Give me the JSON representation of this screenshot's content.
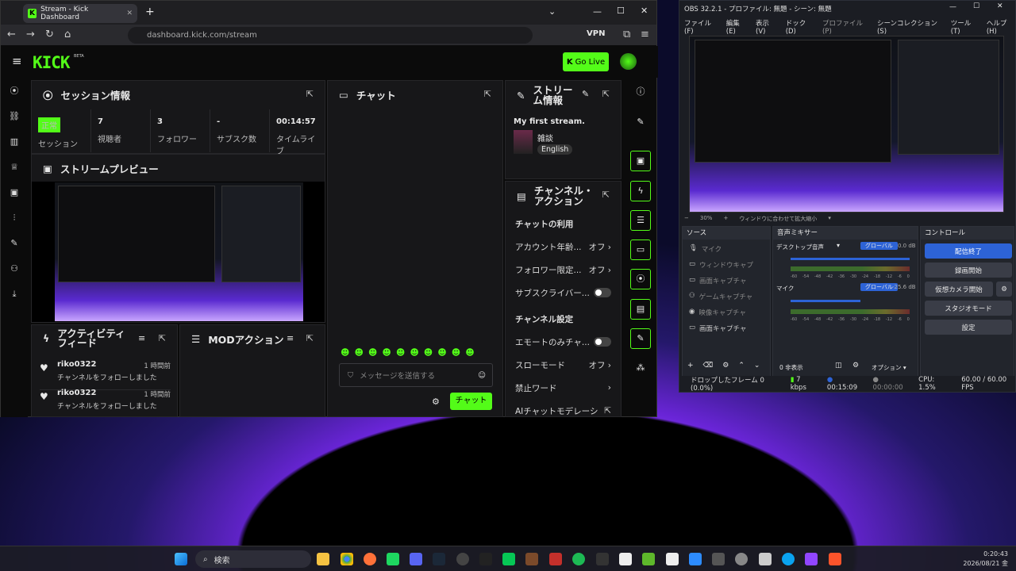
{
  "browser": {
    "tab_title": "Stream - Kick Dashboard",
    "url": "dashboard.kick.com/stream",
    "vpn": "VPN"
  },
  "kick": {
    "logo": "KICK",
    "logo_sup": "BETA",
    "go_live": "Go Live",
    "session": {
      "title": "セッション情報",
      "status_badge": "正常",
      "status_label": "セッション",
      "viewers": "7",
      "viewers_label": "視聴者",
      "followers": "3",
      "followers_label": "フォロワー",
      "subs": "-",
      "subs_label": "サブスク数",
      "time": "00:14:57",
      "time_label": "タイムライブ"
    },
    "preview": {
      "title": "ストリームプレビュー"
    },
    "chat": {
      "title": "チャット",
      "placeholder": "メッセージを送信する",
      "send": "チャット"
    },
    "stream_info": {
      "title": "ストリーム情報",
      "stream_title": "My first stream.",
      "category": "雑談",
      "language": "English"
    },
    "channel_actions": {
      "title": "チャンネル・アクション",
      "chat_usage": "チャットの利用",
      "age": "アカウント年齢...",
      "age_val": "オフ",
      "follower": "フォロワー限定...",
      "follower_val": "オフ",
      "subs": "サブスクライバー...",
      "settings": "チャンネル設定",
      "emote": "エモートのみチャ...",
      "slow": "スローモード",
      "slow_val": "オフ",
      "banned": "禁止ワード",
      "ai": "AIチャットモデレーシ"
    },
    "activity": {
      "title": "アクティビティフィード",
      "items": [
        {
          "user": "riko0322",
          "time": "1 時間前",
          "text": "チャンネルをフォローしました"
        },
        {
          "user": "riko0322",
          "time": "1 時間前",
          "text": "チャンネルをフォローしました"
        }
      ]
    },
    "mod": {
      "title": "MODアクション"
    }
  },
  "obs": {
    "title": "OBS 32.2.1 - プロファイル: 無題 - シーン: 無題",
    "menu": [
      "ファイル(F)",
      "編集(E)",
      "表示(V)",
      "ドック(D)",
      "プロファイル(P)",
      "シーンコレクション(S)",
      "ツール(T)",
      "ヘルプ(H)"
    ],
    "zoom": "30%",
    "zoom_mode": "ウィンドウに合わせて拡大縮小",
    "sources_title": "ソース",
    "sources": [
      "マイク",
      "ウィンドウキャプ",
      "画面キャプチャ",
      "ゲームキャプチャ",
      "映像キャプチャ",
      "画面キャプチャ"
    ],
    "mixer_title": "音声ミキサー",
    "desktop": "デスクトップ音声",
    "global": "グローバル",
    "desktop_db": "0.0 dB",
    "mic": "マイク",
    "mic_db": "-25.6 dB",
    "scale": [
      "-60",
      "-54",
      "-48",
      "-42",
      "-36",
      "-30",
      "-24",
      "-18",
      "-12",
      "-6",
      "0"
    ],
    "hidden": "0 非表示",
    "options": "オプション",
    "controls_title": "コントロール",
    "controls": [
      "配信終了",
      "録画開始",
      "仮想カメラ開始",
      "スタジオモード",
      "設定"
    ],
    "status": {
      "dropped": "ドロップしたフレーム 0 (0.0%)",
      "kbps": "7 kbps",
      "stream_time": "00:15:09",
      "rec_time": "00:00:00",
      "cpu": "CPU: 1.5%",
      "fps": "60.00 / 60.00 FPS"
    }
  },
  "taskbar": {
    "search": "検索",
    "time": "0:20:43",
    "date": "2026/08/21 金"
  }
}
